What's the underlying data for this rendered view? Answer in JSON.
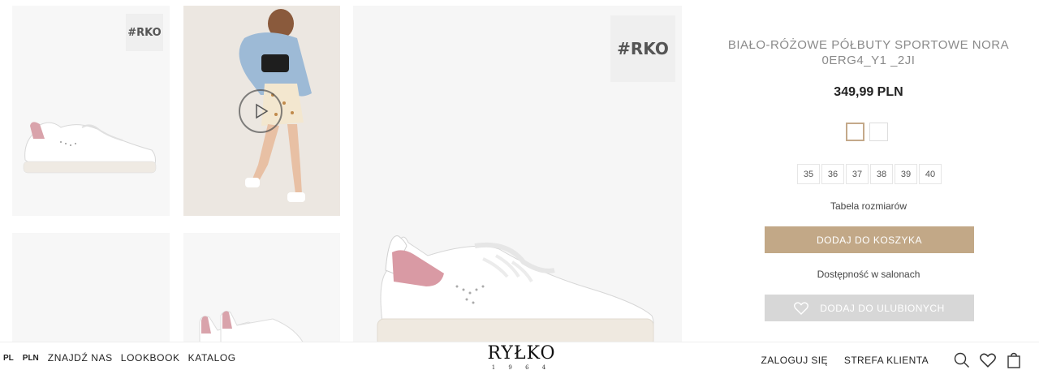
{
  "gallery": {
    "badge_small": "#RKO",
    "badge_large": "#RKO"
  },
  "product": {
    "title": "BIAŁO-RÓŻOWE PÓŁBUTY SPORTOWE NORA 0ERG4_Y1 _2JI",
    "price": "349,99 PLN",
    "sizes": [
      "35",
      "36",
      "37",
      "38",
      "39",
      "40"
    ],
    "size_table_label": "Tabela rozmiarów",
    "add_to_cart_label": "DODAJ DO KOSZYKA",
    "availability_label": "Dostępność w salonach",
    "add_to_favorites_label": "DODAJ DO ULUBIONYCH"
  },
  "footer_nav": {
    "lang": "PL",
    "currency": "PLN",
    "find_us": "ZNAJDŹ NAS",
    "lookbook": "LOOKBOOK",
    "catalog": "KATALOG",
    "login": "ZALOGUJ SIĘ",
    "customer_zone": "STREFA KLIENTA"
  },
  "logo": {
    "name": "RYŁKO",
    "year": "1 9 6 4"
  },
  "colors": {
    "accent": "#c2a887",
    "favorites_button": "#d7d7d7"
  }
}
